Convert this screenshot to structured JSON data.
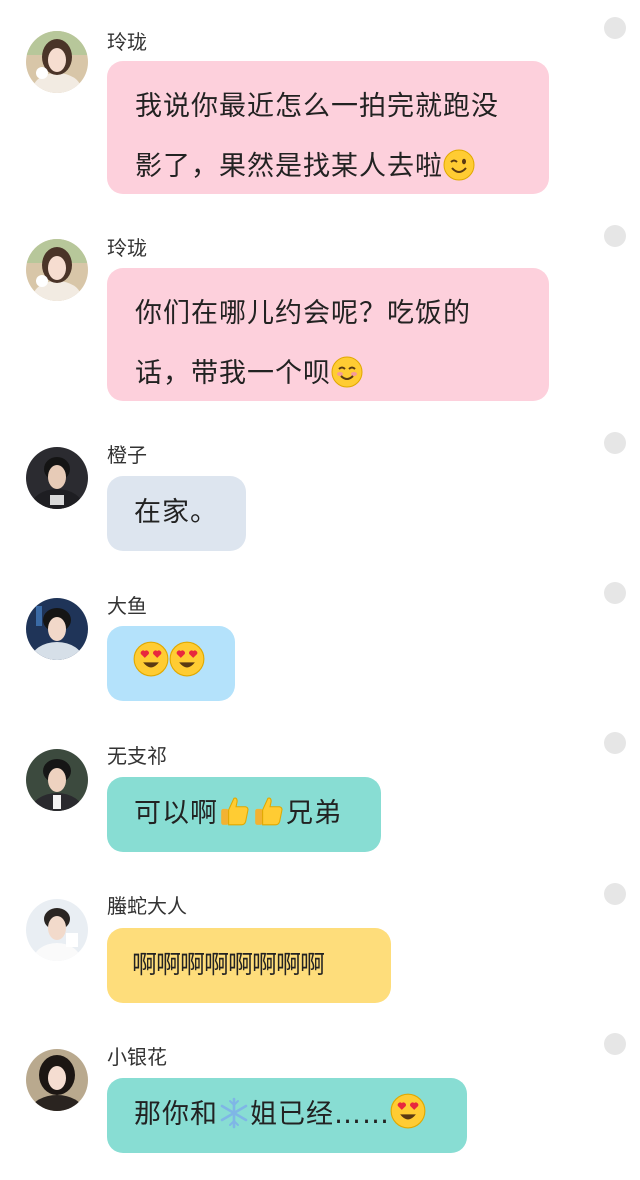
{
  "messages": [
    {
      "sender": "玲珑",
      "text": "我说你最近怎么一拍完就跑没影了，果然是找某人去啦",
      "emoji_end": "wink-emoji",
      "bubble_color": "#fdd0dc",
      "avatar": "avatar-lingling"
    },
    {
      "sender": "玲珑",
      "text": "你们在哪儿约会呢？吃饭的话，带我一个呗",
      "emoji_end": "smile-emoji",
      "bubble_color": "#fdd0dc",
      "avatar": "avatar-lingling"
    },
    {
      "sender": "橙子",
      "text": "在家。",
      "bubble_color": "#dde5ef",
      "avatar": "avatar-chengzi"
    },
    {
      "sender": "大鱼",
      "text": "",
      "emojis": [
        "heart-eyes-emoji",
        "heart-eyes-emoji"
      ],
      "bubble_color": "#b4e2fb",
      "avatar": "avatar-dayu"
    },
    {
      "sender": "无支祁",
      "text_parts": [
        "可以啊",
        "兄弟"
      ],
      "emojis": [
        "thumbs-up-emoji",
        "thumbs-up-emoji"
      ],
      "bubble_color": "#88ddd3",
      "avatar": "avatar-wuzhiqi"
    },
    {
      "sender": "螣蛇大人",
      "text": "啊啊啊啊啊啊啊啊",
      "bubble_color": "#fedd7b",
      "avatar": "avatar-tengshe"
    },
    {
      "sender": "小银花",
      "text_parts": [
        "那你和",
        "姐已经……"
      ],
      "emojis": [
        "snowflake-emoji",
        "heart-eyes-emoji"
      ],
      "bubble_color": "#88ddd3",
      "avatar": "avatar-xiaoyinhua"
    }
  ],
  "colors": {
    "status_dot": "#e6e6e6",
    "name_text": "#333333",
    "message_text": "#222222"
  }
}
